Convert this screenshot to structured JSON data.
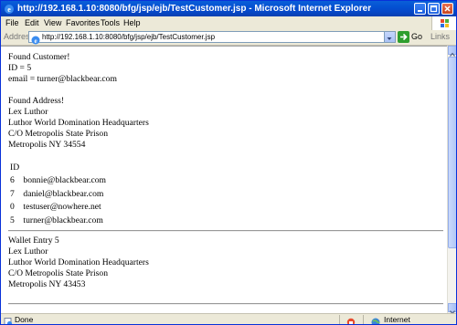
{
  "window": {
    "title": "http://192.168.1.10:8080/bfg/jsp/ejb/TestCustomer.jsp - Microsoft Internet Explorer"
  },
  "menu": {
    "items": [
      "File",
      "Edit",
      "View",
      "Favorites",
      "Tools",
      "Help"
    ]
  },
  "address_bar": {
    "label": "Address",
    "url": "http://192.168.1.10:8080/bfg/jsp/ejb/TestCustomer.jsp",
    "go_label": "Go",
    "links_label": "Links"
  },
  "page": {
    "customer": {
      "heading": "Found Customer!",
      "id_line": "ID = 5",
      "email_line": "email = turner@blackbear.com"
    },
    "address": {
      "heading": "Found Address!",
      "lines": [
        "Lex Luthor",
        "Luthor World Domination Headquarters",
        "C/O Metropolis State Prison",
        "Metropolis NY 34554"
      ]
    },
    "email_table": {
      "header": "ID",
      "rows": [
        {
          "id": "6",
          "email": "bonnie@blackbear.com"
        },
        {
          "id": "7",
          "email": "daniel@blackbear.com"
        },
        {
          "id": "0",
          "email": "testuser@nowhere.net"
        },
        {
          "id": "5",
          "email": "turner@blackbear.com"
        }
      ]
    },
    "wallet": {
      "heading": "Wallet Entry 5",
      "lines": [
        "Lex Luthor",
        "Luthor World Domination Headquarters",
        "C/O Metropolis State Prison",
        "Metropolis NY 43453"
      ]
    }
  },
  "status_bar": {
    "status": "Done",
    "zone": "Internet"
  },
  "colors": {
    "titlebar": "#0450d2",
    "chrome": "#ece9d8",
    "content_bg": "#ffffff"
  },
  "icons": [
    "ie-icon",
    "minimize-icon",
    "maximize-icon",
    "close-icon",
    "windows-logo-icon",
    "dropdown-icon",
    "go-arrow-icon",
    "page-done-icon",
    "security-icon",
    "internet-zone-icon"
  ]
}
